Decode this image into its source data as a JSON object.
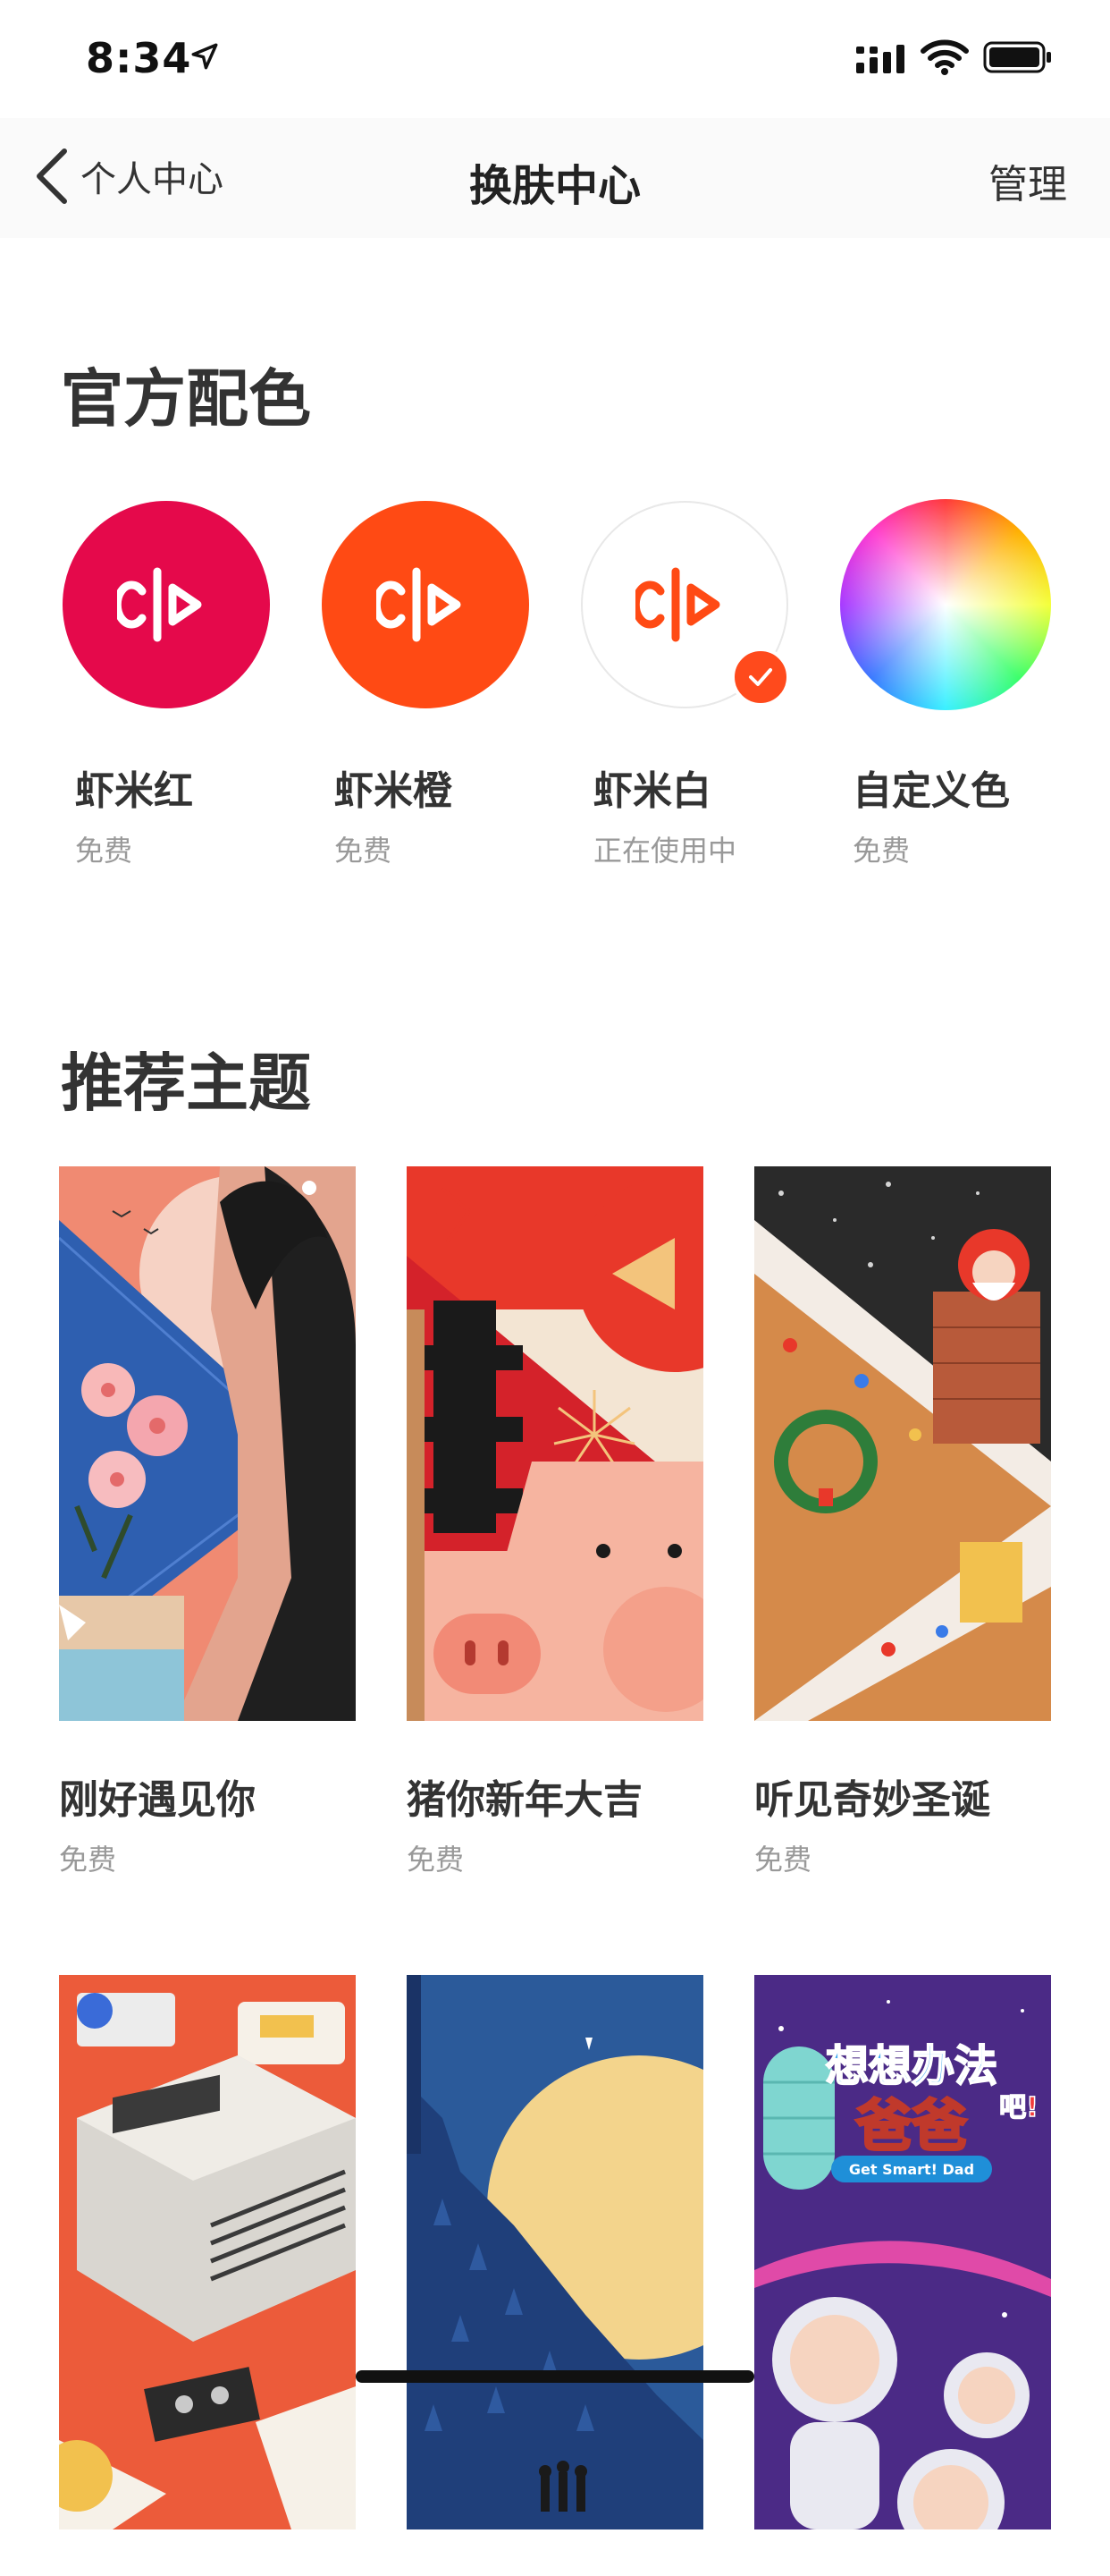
{
  "status_bar": {
    "time": "8:34"
  },
  "nav": {
    "back_label": "个人中心",
    "title": "换肤中心",
    "manage_label": "管理"
  },
  "official": {
    "title": "官方配色",
    "items": [
      {
        "name": "虾米红",
        "status": "免费",
        "color": "#e5094b"
      },
      {
        "name": "虾米橙",
        "status": "免费",
        "color": "#ff4a14"
      },
      {
        "name": "虾米白",
        "status": "正在使用中",
        "color": "#ffffff"
      },
      {
        "name": "自定义色",
        "status": "免费",
        "color": "rainbow"
      }
    ]
  },
  "recommended": {
    "title": "推荐主题",
    "items": [
      {
        "name": "刚好遇见你",
        "price": "免费"
      },
      {
        "name": "猪你新年大吉",
        "price": "免费"
      },
      {
        "name": "听见奇妙圣诞",
        "price": "免费"
      },
      {
        "name": "",
        "price": ""
      },
      {
        "name": "",
        "price": ""
      },
      {
        "name": "",
        "price": ""
      }
    ],
    "poster_text": {
      "title": "想想办法",
      "subtitle": "爸爸",
      "exclaim": "吧!",
      "english": "Get Smart! Dad"
    }
  },
  "colors": {
    "accent": "#ff4a14",
    "text": "#333333",
    "muted": "#999999"
  }
}
